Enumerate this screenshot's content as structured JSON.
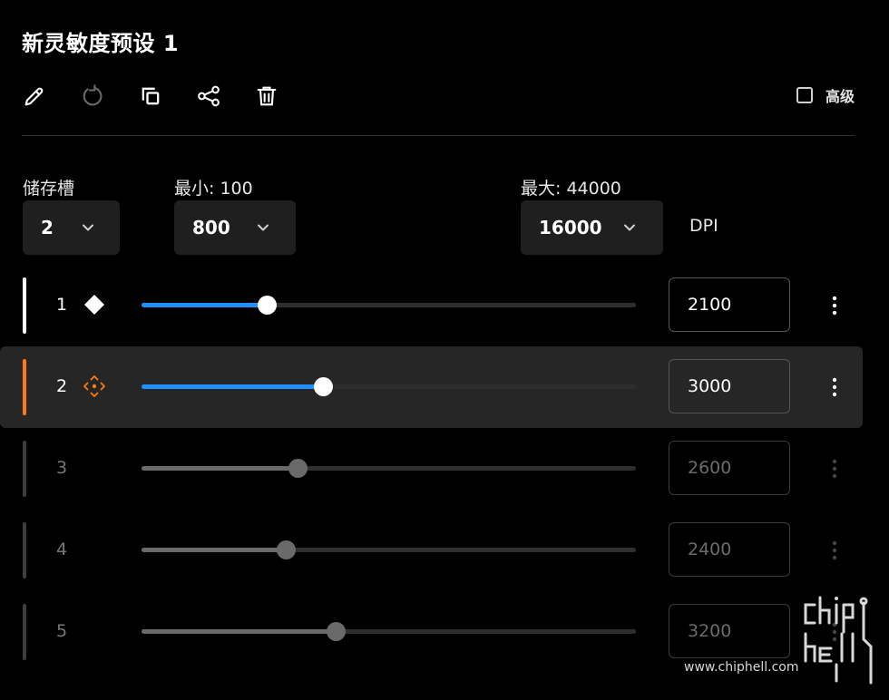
{
  "title": "新灵敏度预设 1",
  "toolbar": {
    "icons": [
      "pencil-icon",
      "reset-icon",
      "copy-icon",
      "share-icon",
      "trash-icon"
    ],
    "advanced_label": "高级",
    "advanced_checked": false
  },
  "slot": {
    "label": "储存槽",
    "value": "2"
  },
  "min": {
    "label": "最小: 100",
    "value": "800"
  },
  "max": {
    "label": "最大: 44000",
    "value": "16000"
  },
  "unit": "DPI",
  "slider": {
    "min": 100,
    "max": 8000
  },
  "rows": [
    {
      "index": "1",
      "value": "2100",
      "dpi": 2100,
      "indicator": "diamond-icon",
      "state": "active"
    },
    {
      "index": "2",
      "value": "3000",
      "dpi": 3000,
      "indicator": "move-icon",
      "state": "selected"
    },
    {
      "index": "3",
      "value": "2600",
      "dpi": 2600,
      "indicator": "",
      "state": "disabled"
    },
    {
      "index": "4",
      "value": "2400",
      "dpi": 2400,
      "indicator": "",
      "state": "disabled"
    },
    {
      "index": "5",
      "value": "3200",
      "dpi": 3200,
      "indicator": "",
      "state": "disabled"
    }
  ],
  "colors": {
    "accent_blue": "#1e90ff",
    "selected_orange": "#ff7a12",
    "dim_gray": "#6a6a6a",
    "track": "#2e2e2e"
  },
  "watermark": {
    "text": "www.chiphell.com",
    "logo": "chiphell-logo"
  }
}
